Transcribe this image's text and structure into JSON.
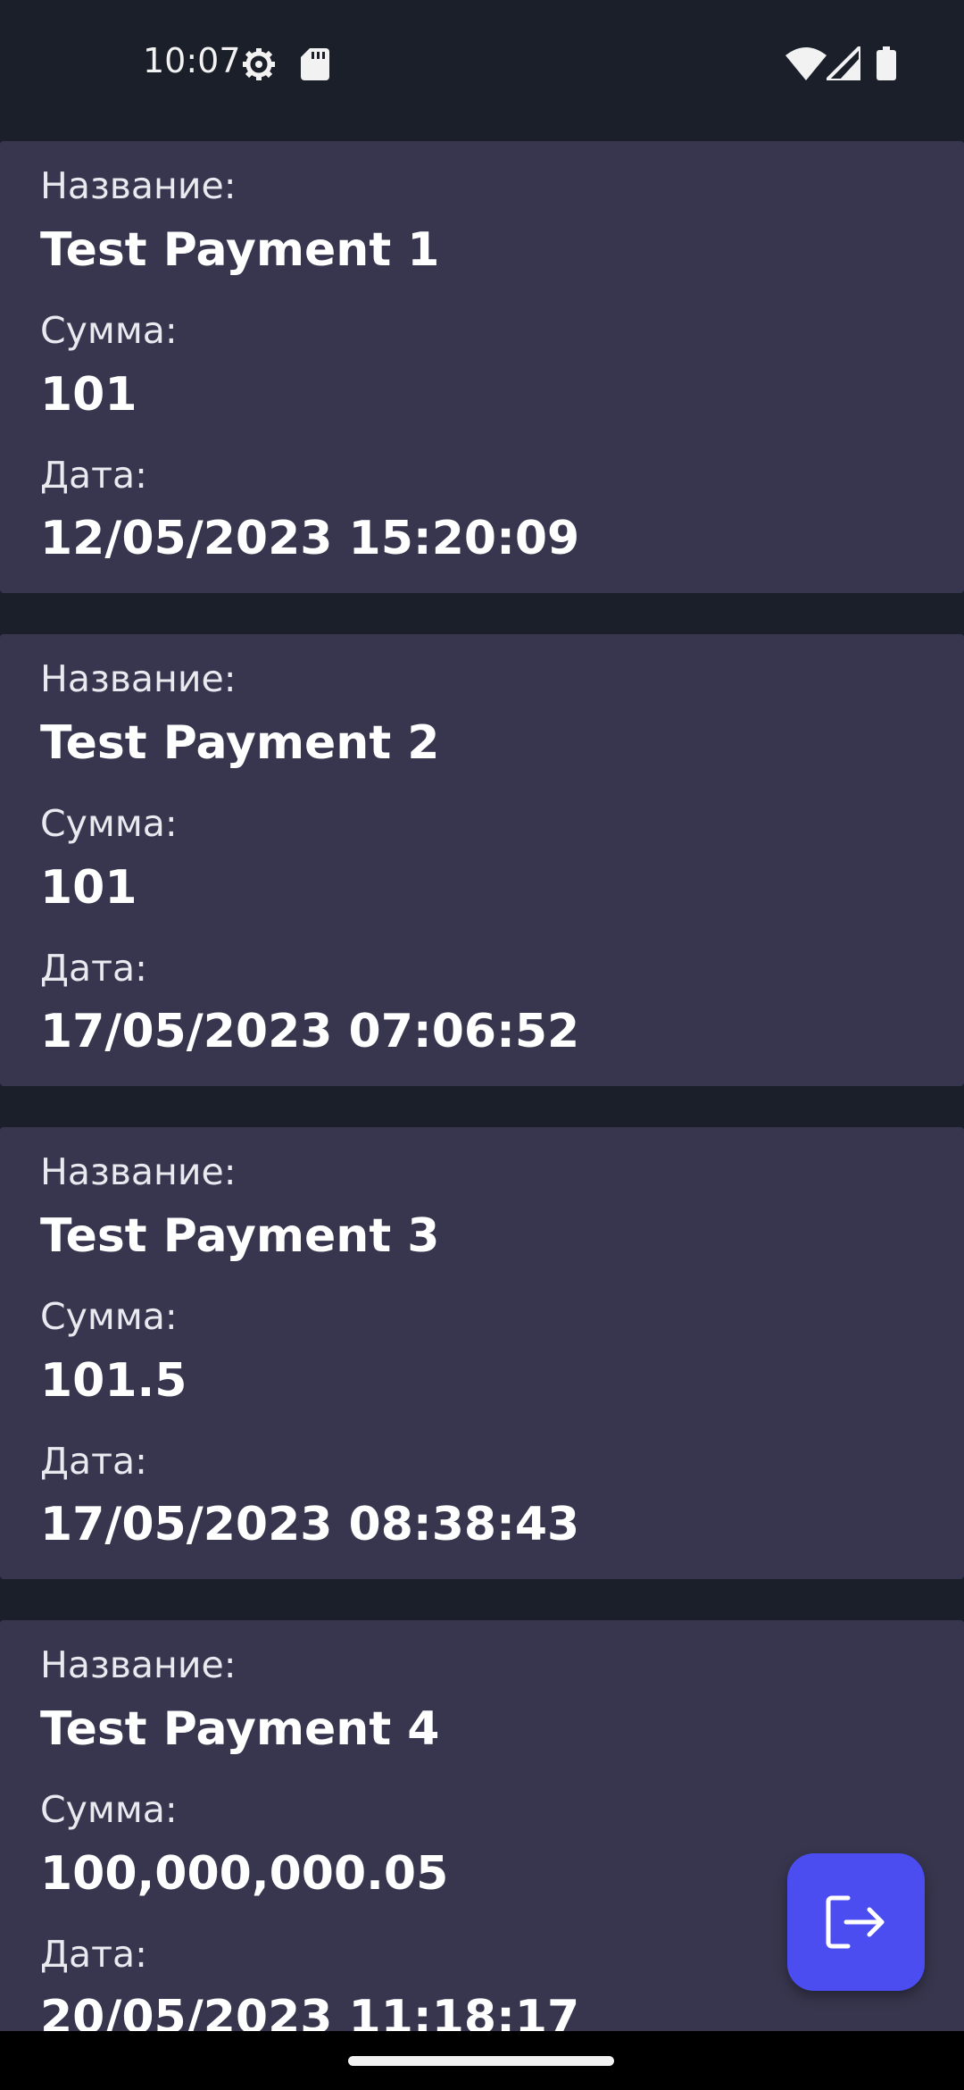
{
  "status_bar": {
    "time": "10:07",
    "icons": [
      "settings-icon",
      "sd-card-icon",
      "wifi-icon",
      "signal-icon",
      "battery-icon"
    ]
  },
  "payments": [
    {
      "name_label": "Название:",
      "name": "Test Payment 1",
      "amount_label": "Сумма:",
      "amount": "101",
      "date_label": "Дата:",
      "date": "12/05/2023 15:20:09"
    },
    {
      "name_label": "Название:",
      "name": "Test Payment 2",
      "amount_label": "Сумма:",
      "amount": "101",
      "date_label": "Дата:",
      "date": "17/05/2023 07:06:52"
    },
    {
      "name_label": "Название:",
      "name": "Test Payment 3",
      "amount_label": "Сумма:",
      "amount": "101.5",
      "date_label": "Дата:",
      "date": "17/05/2023 08:38:43"
    },
    {
      "name_label": "Название:",
      "name": "Test Payment 4",
      "amount_label": "Сумма:",
      "amount": "100,000,000.05",
      "date_label": "Дата:",
      "date": "20/05/2023 11:18:17"
    }
  ],
  "fab": {
    "icon": "logout-icon"
  },
  "colors": {
    "background": "#1a1f2a",
    "card": "#37364e",
    "fab": "#4b4df0"
  }
}
